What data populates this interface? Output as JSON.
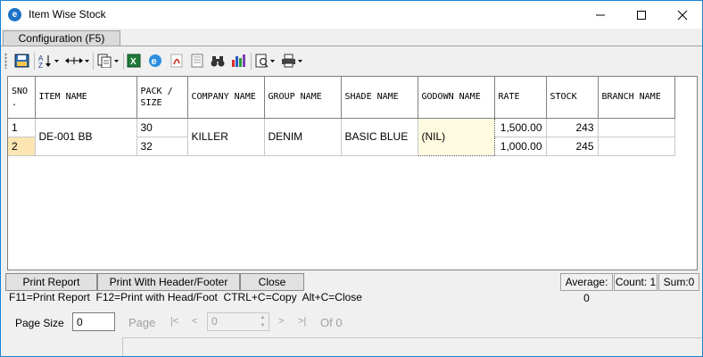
{
  "window": {
    "title": "Item Wise Stock"
  },
  "tabs": {
    "configuration": "Configuration (F5)"
  },
  "table": {
    "headers": [
      "SNO\n.",
      "ITEM NAME",
      "PACK /\nSIZE",
      "COMPANY NAME",
      "GROUP NAME",
      "SHADE NAME",
      "GODOWN NAME",
      "RATE",
      "STOCK",
      "BRANCH NAME"
    ],
    "rows": [
      {
        "sno": "1",
        "pack_size": "30",
        "rate": "1,500.00",
        "stock": "243",
        "branch_name": ""
      },
      {
        "sno": "2",
        "pack_size": "32",
        "rate": "1,000.00",
        "stock": "245",
        "branch_name": ""
      }
    ],
    "merged": {
      "item_name": "DE-001 BB",
      "company_name": "KILLER",
      "group_name": "DENIM",
      "shade_name": "BASIC BLUE",
      "godown_name": "(NIL)"
    }
  },
  "buttons": {
    "print_report": "Print Report",
    "print_header_footer": "Print With Header/Footer",
    "close": "Close"
  },
  "stats": {
    "average": "Average: 0",
    "count": "Count: 1",
    "sum": "Sum:0"
  },
  "shortcuts": "F11=Print Report  F12=Print with Head/Foot  CTRL+C=Copy  Alt+C=Close",
  "pager": {
    "page_size_label": "Page Size",
    "page_size_value": "0",
    "page_label": "Page",
    "page_value": "0",
    "of_label": "Of 0",
    "first": "|<",
    "prev": "<",
    "next": ">",
    "last": ">|"
  },
  "colors": {
    "selected_row": "#fde5b2",
    "window_border": "#1883d7",
    "focused_cell": "#fefbe0"
  }
}
